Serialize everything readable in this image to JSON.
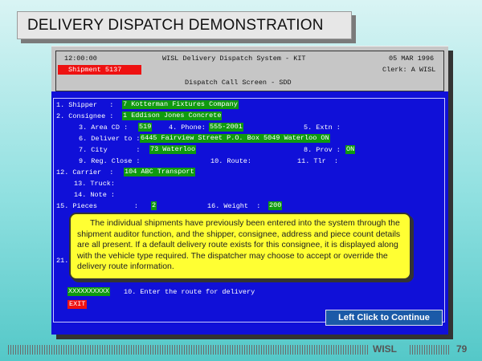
{
  "slide_title": "DELIVERY DISPATCH DEMONSTRATION",
  "terminal": {
    "header": {
      "time": "12:00:00",
      "system_name": "WISL Delivery Dispatch System - KIT",
      "date": "05 MAR 1996",
      "shipment_badge": "Shipment 5137",
      "clerk": "Clerk: A WISL",
      "screen_name": "Dispatch Call Screen - SDD"
    },
    "fields": {
      "shipper_label": "1. Shipper   :",
      "shipper_value": "7 Kotterman Fixtures Company",
      "consignee_label": "2. Consignee :",
      "consignee_value": "1 Eddison Jones Concrete",
      "area_label": "3. Area CD :",
      "area_value": "519",
      "phone_label": "4. Phone:",
      "phone_value": "555-2001",
      "extn_label": "5. Extn :",
      "deliver_label": "6. Deliver to :",
      "deliver_value": "6445 Fairview Street P.O. Box 5049 Waterloo ON",
      "city_label": "7. City       :",
      "city_value": "73 Waterloo",
      "prov_label": "8. Prov :",
      "prov_value": "ON",
      "regclose_label": "9. Reg. Close :",
      "route_label": "10. Route:",
      "tlr_label": "11. Tlr  :",
      "carrier_label": "12. Carrier  :",
      "carrier_value": "104 ABC Transport",
      "truck_label": "13. Truck:",
      "note_label": "14. Note :",
      "pieces_label": "15. Pieces         :",
      "pieces_value": "2",
      "weight_label": "16. Weight  :",
      "weight_value": "200",
      "hidden_field_label": "21.",
      "route_input_value": "XXXXXXXXXX",
      "route_prompt": "10. Enter the route for delivery",
      "exit_label": "EXIT"
    }
  },
  "tooltip_text": "The individual shipments have previously been entered into the system through the shipment auditor function, and the shipper, consignee, address and piece count details are all present. If a default delivery route exists for this consignee, it is displayed along with the vehicle type required. The dispatcher may choose to accept or override the delivery route information.",
  "continue_button": "Left Click to Continue",
  "footer": {
    "brand": "WISL",
    "page_number": "79"
  },
  "colors": {
    "terminal_blue": "#1010d8",
    "field_green": "#0f9a0f",
    "badge_red": "#ee1111",
    "tooltip_yellow": "#ffff33",
    "button_blue": "#1b5aa8"
  }
}
